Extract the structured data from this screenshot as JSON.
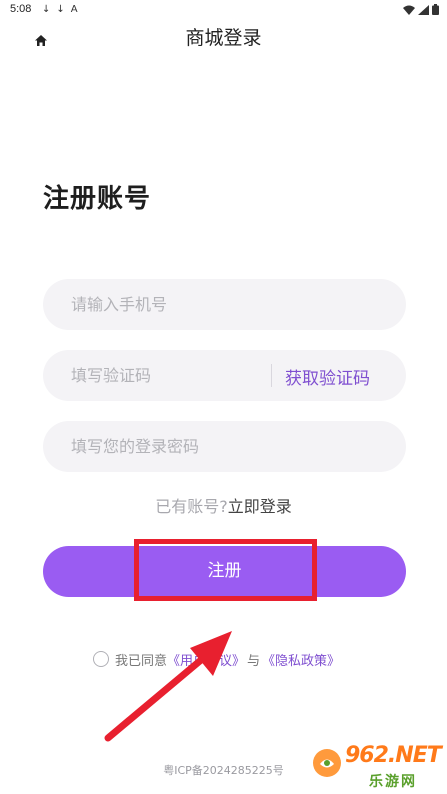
{
  "status_bar": {
    "time": "5:08",
    "left_glyphs": [
      "↓",
      "↓",
      "A"
    ]
  },
  "header": {
    "title": "商城登录",
    "home_icon": "home-icon"
  },
  "form": {
    "heading": "注册账号",
    "phone_placeholder": "请输入手机号",
    "code_placeholder": "填写验证码",
    "get_code_label": "获取验证码",
    "password_placeholder": "填写您的登录密码",
    "have_account_text": "已有账号?",
    "login_link": "立即登录",
    "register_label": "注册"
  },
  "agreement": {
    "prefix": "我已同意",
    "user_agreement": "《用户协议》",
    "join": "与",
    "privacy_policy": "《隐私政策》"
  },
  "footer": {
    "icp": "粤ICP备2024285225号"
  },
  "watermark": {
    "brand": "962.NET",
    "sub": "乐游网"
  },
  "colors": {
    "accent": "#9a5cf2",
    "link": "#7f4fd0",
    "highlight": "#e8202f"
  }
}
